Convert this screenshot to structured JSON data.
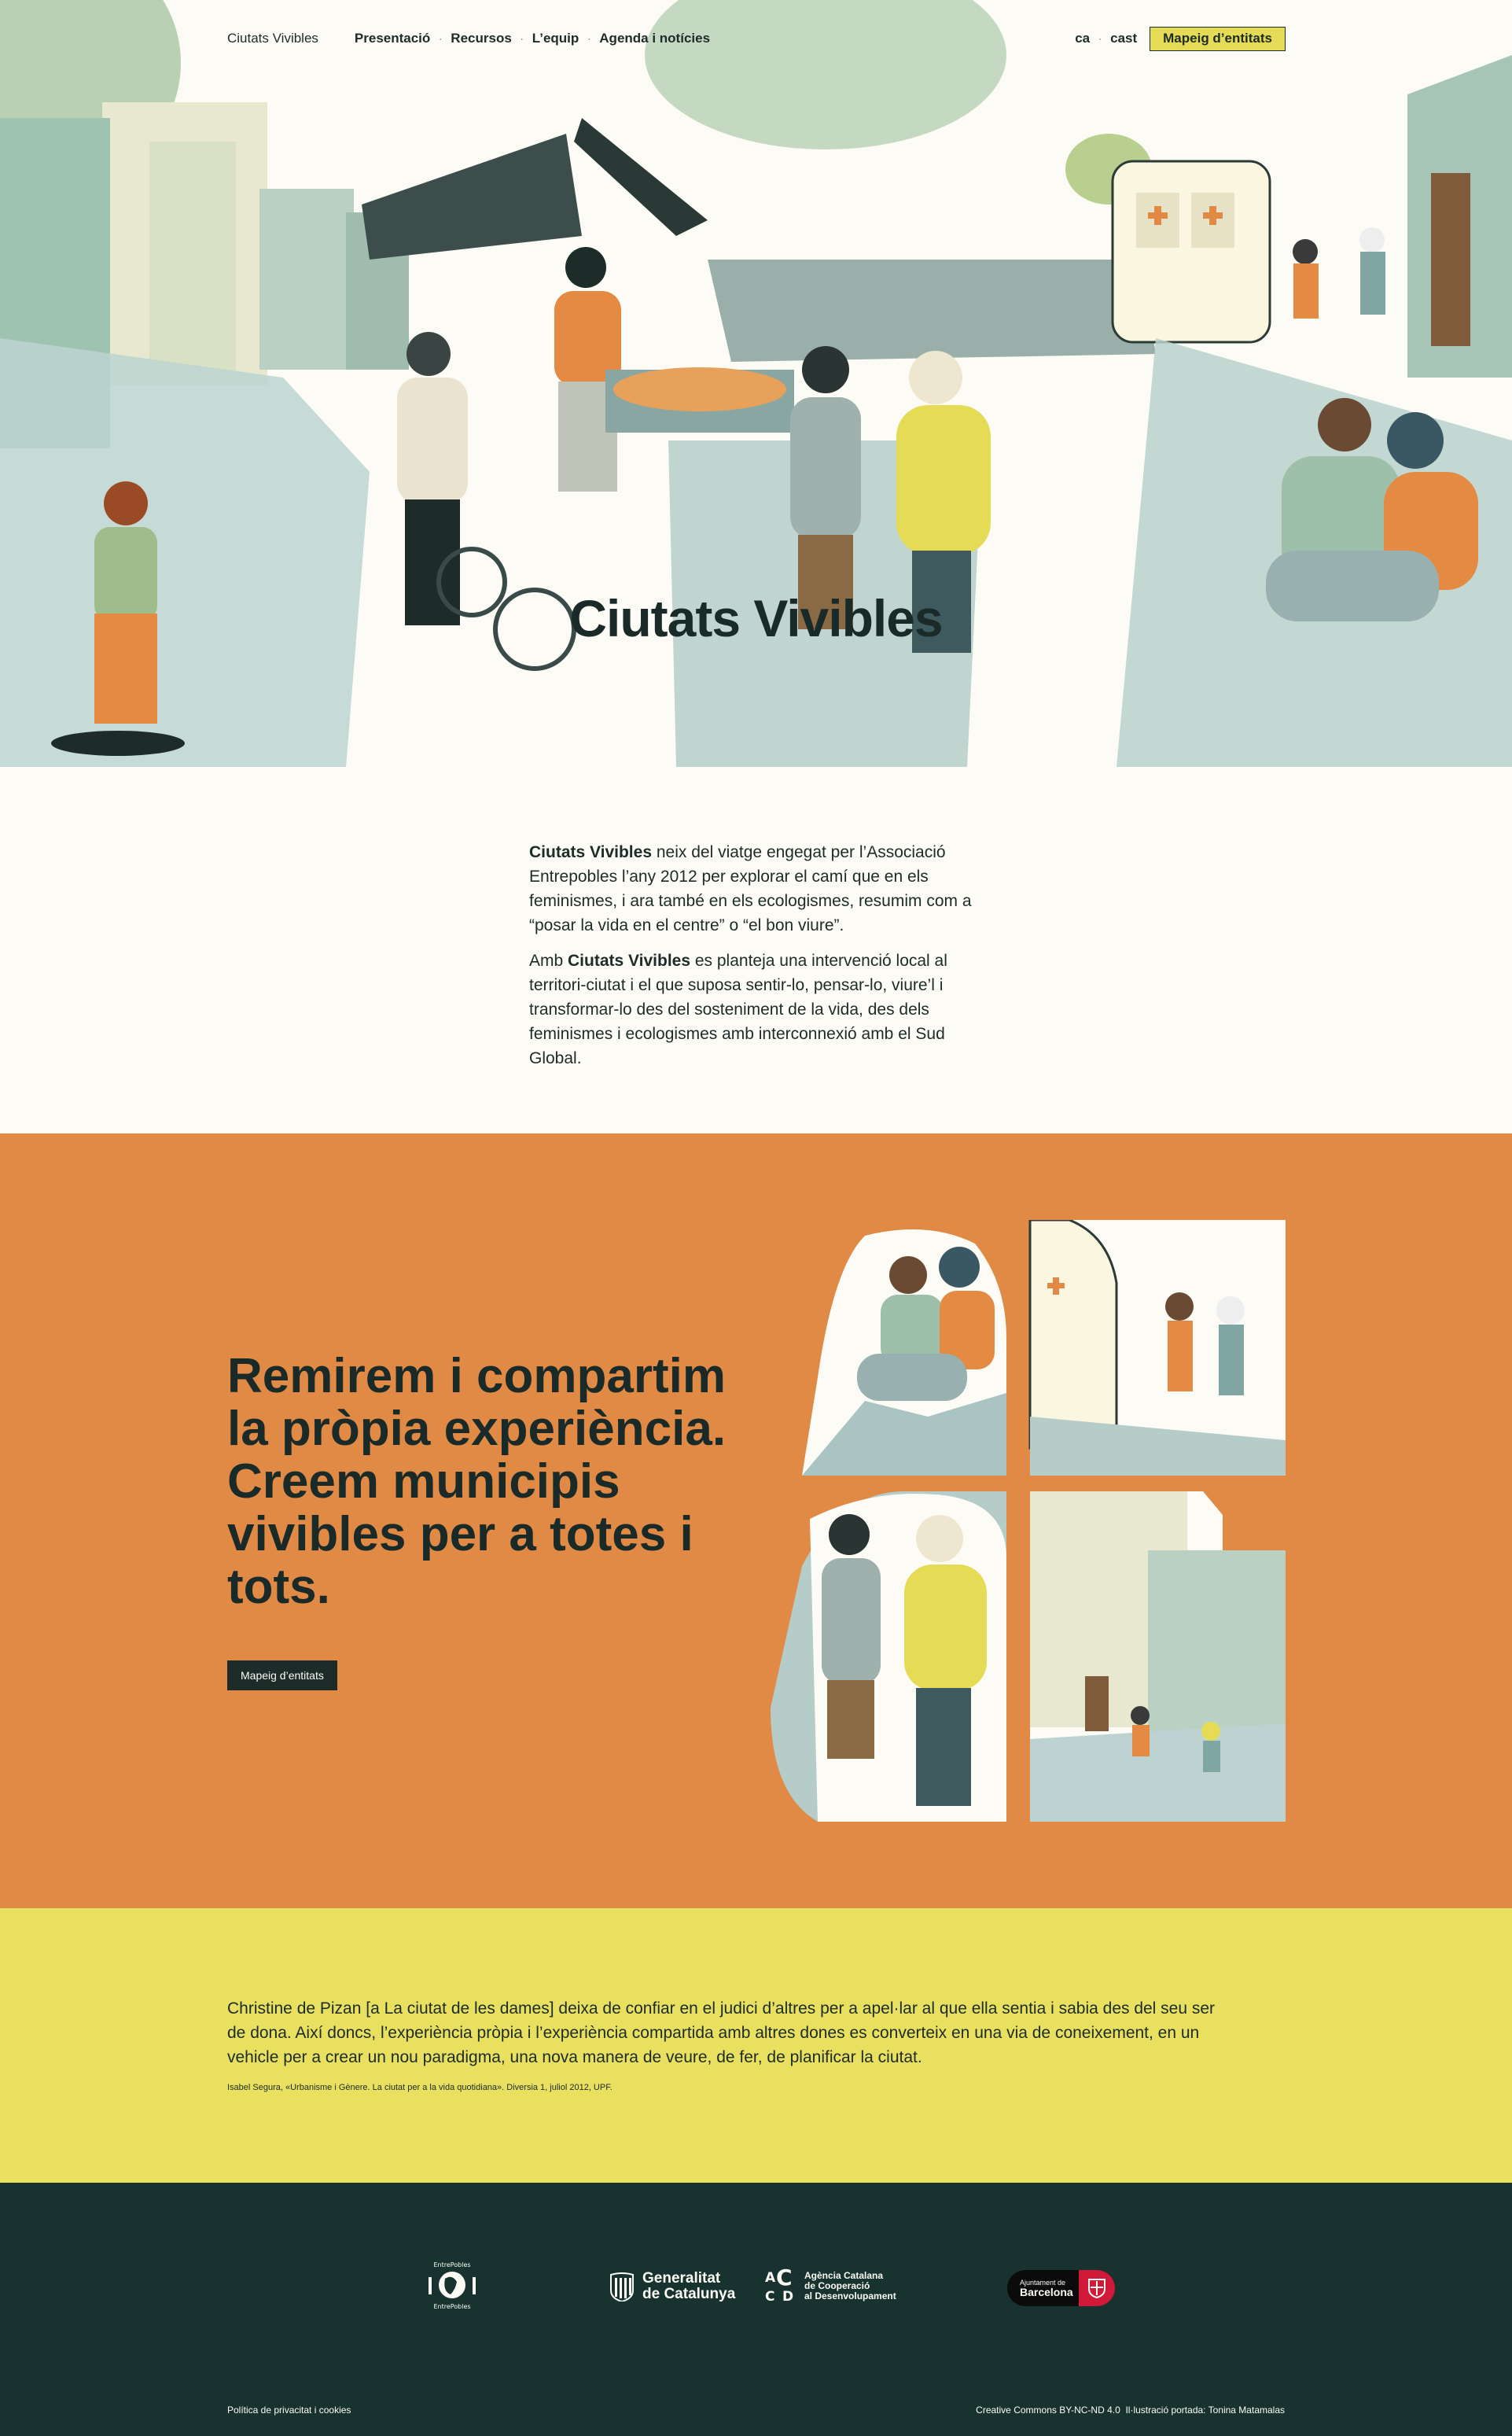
{
  "nav": {
    "brand": "Ciutats Vivibles",
    "items": [
      "Presentació",
      "Recursos",
      "L’equip",
      "Agenda i notícies"
    ],
    "languages": [
      "ca",
      "cast"
    ],
    "cta": "Mapeig d’entitats"
  },
  "hero": {
    "title": "Ciutats Vivibles"
  },
  "intro": {
    "p1_bold": "Ciutats Vivibles",
    "p1_rest": " neix del viatge engegat per l’Associació Entrepobles l’any 2012 per explorar el camí que en els feminismes, i ara també en els ecologismes, resumim com a “posar la vida en el centre” o “el bon viure”.",
    "p2_start": "Amb ",
    "p2_bold": "Ciutats Vivibles",
    "p2_rest": " es planteja una intervenció local al territori-ciutat i el que suposa sentir-lo, pensar-lo, viure’l i transformar-lo des del sosteniment de la vida, des dels feminismes i ecologismes amb interconnexió amb el Sud Global."
  },
  "experience": {
    "heading": "Remirem i compartim la pròpia experiència. Creem municipis vivibles per a totes i tots.",
    "button": "Mapeig d’entitats"
  },
  "quote": {
    "text": "Christine de Pizan [a La ciutat de les dames] deixa de confiar en el judici d’altres per a apel·lar al que ella sentia i sabia des del seu ser de dona. Així doncs, l’experiència pròpia i l’experiència compartida amb altres dones es converteix en una via de coneixement, en un vehicle per a crear un nou paradigma, una nova manera de veure, de fer, de planificar la ciutat.",
    "citation": "Isabel Segura, «Urbanisme i Gènere. La ciutat per a la vida quotidiana». Diversia 1, juliol 2012, UPF."
  },
  "footer": {
    "logos": {
      "entrepobles": "EntrePobles",
      "generalitat": [
        "Generalitat",
        "de Catalunya"
      ],
      "acccd": [
        "Agència Catalana",
        "de Cooperació",
        "al Desenvolupament"
      ],
      "barcelona": [
        "Ajuntament de",
        "Barcelona"
      ]
    },
    "privacy": "Política de privacitat i cookies",
    "credits": "Creative Commons BY-NC-ND 4.0  Il·lustració portada: Tonina Matamalas"
  },
  "colors": {
    "background": "#fcfbf5",
    "dark": "#1d2b29",
    "orange": "#e08a45",
    "yellow": "#e8e05e",
    "footer": "#18332f",
    "button_yellow": "#e6db55"
  }
}
